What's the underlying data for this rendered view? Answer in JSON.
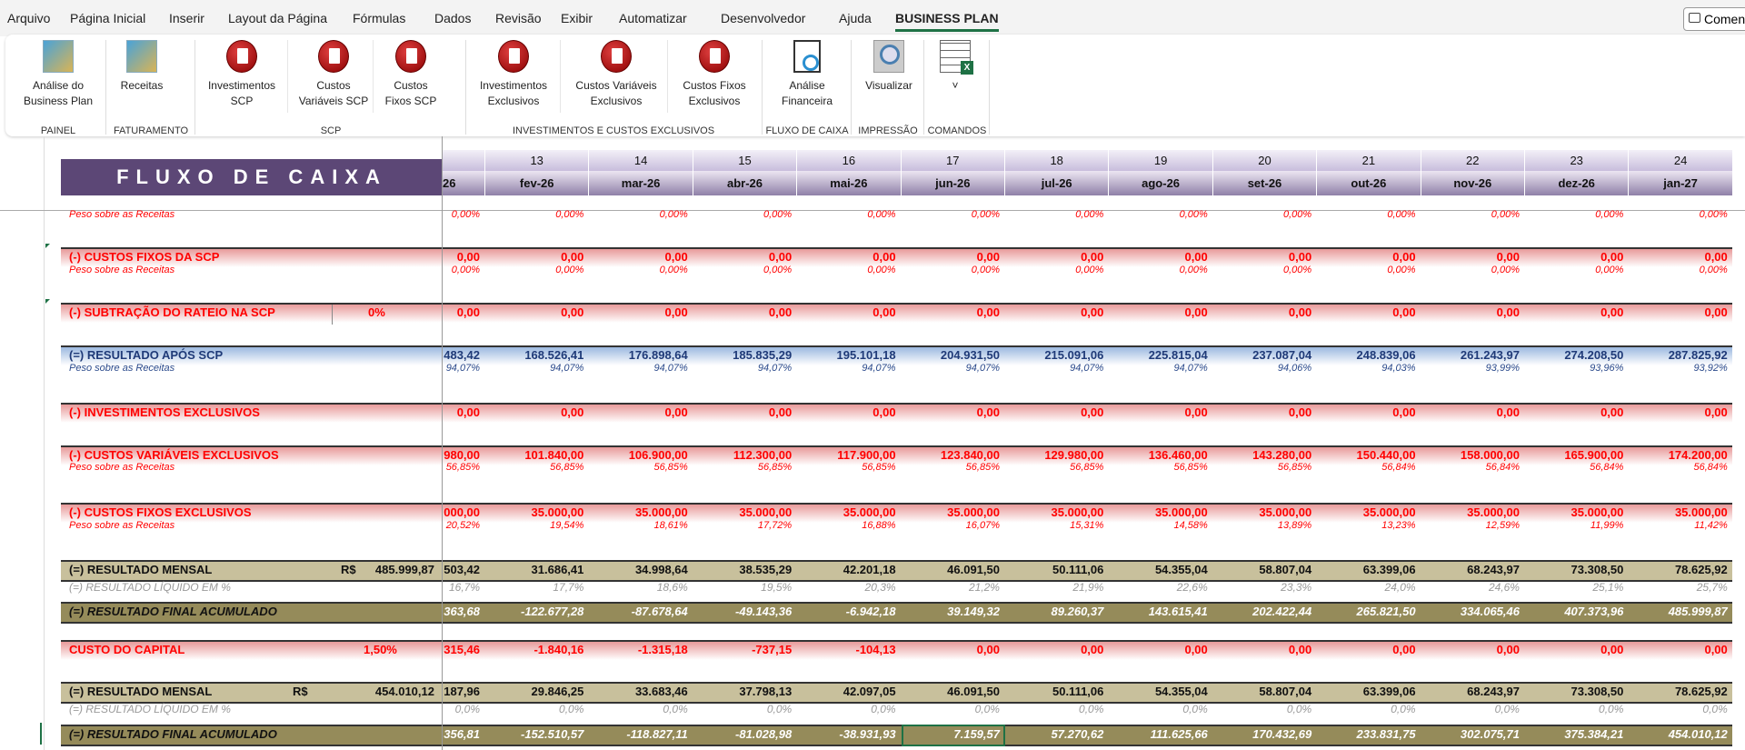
{
  "menu": [
    "Arquivo",
    "Página Inicial",
    "Inserir",
    "Layout da Página",
    "Fórmulas",
    "Dados",
    "Revisão",
    "Exibir",
    "Automatizar",
    "Desenvolvedor",
    "Ajuda",
    "BUSINESS PLAN"
  ],
  "comments_label": "Comentários",
  "ribbon": {
    "buttons": [
      {
        "label1": "Análise do",
        "label2": "Business Plan",
        "icon": "business-chart-icon"
      },
      {
        "label1": "Receitas",
        "label2": "",
        "icon": "growth-bars-icon"
      },
      {
        "label1": "Investimentos",
        "label2": "SCP",
        "icon": "red-document-icon"
      },
      {
        "label1": "Custos",
        "label2": "Variáveis SCP",
        "icon": "red-document-icon"
      },
      {
        "label1": "Custos",
        "label2": "Fixos SCP",
        "icon": "red-document-icon"
      },
      {
        "label1": "Investimentos",
        "label2": "Exclusivos",
        "icon": "red-document-icon"
      },
      {
        "label1": "Custos Variáveis",
        "label2": "Exclusivos",
        "icon": "red-document-icon"
      },
      {
        "label1": "Custos Fixos",
        "label2": "Exclusivos",
        "icon": "red-document-icon"
      },
      {
        "label1": "Análise",
        "label2": "Financeira",
        "icon": "report-magnifier-icon"
      },
      {
        "label1": "Visualizar",
        "label2": "",
        "icon": "print-preview-icon"
      },
      {
        "label1": "",
        "label2": "˅",
        "icon": "excel-grid-icon"
      }
    ],
    "groups": [
      "PAINEL",
      "FATURAMENTO",
      "SCP",
      "INVESTIMENTOS E CUSTOS EXCLUSIVOS",
      "FLUXO DE CAIXA",
      "IMPRESSÃO",
      "COMANDOS"
    ]
  },
  "sheet": {
    "title": "FLUXO DE CAIXA",
    "header_numbers": [
      "",
      "13",
      "14",
      "15",
      "16",
      "17",
      "18",
      "19",
      "20",
      "21",
      "22",
      "23",
      "24"
    ],
    "header_months": [
      "26",
      "fev-26",
      "mar-26",
      "abr-26",
      "mai-26",
      "jun-26",
      "jul-26",
      "ago-26",
      "set-26",
      "out-26",
      "nov-26",
      "dez-26",
      "jan-27"
    ],
    "rows": [
      {
        "kind": "peso-red",
        "label": "Peso sobre as Receitas",
        "values": [
          "0,00%",
          "0,00%",
          "0,00%",
          "0,00%",
          "0,00%",
          "0,00%",
          "0,00%",
          "0,00%",
          "0,00%",
          "0,00%",
          "0,00%",
          "0,00%",
          "0,00%"
        ]
      },
      {
        "kind": "red",
        "label": "(-) CUSTOS FIXOS DA SCP",
        "values": [
          "0,00",
          "0,00",
          "0,00",
          "0,00",
          "0,00",
          "0,00",
          "0,00",
          "0,00",
          "0,00",
          "0,00",
          "0,00",
          "0,00",
          "0,00"
        ]
      },
      {
        "kind": "peso-red",
        "label": "Peso sobre as Receitas",
        "values": [
          "0,00%",
          "0,00%",
          "0,00%",
          "0,00%",
          "0,00%",
          "0,00%",
          "0,00%",
          "0,00%",
          "0,00%",
          "0,00%",
          "0,00%",
          "0,00%",
          "0,00%"
        ]
      },
      {
        "kind": "red",
        "label": "(-) SUBTRAÇÃO DO RATEIO NA SCP",
        "extra": "0%",
        "values": [
          "0,00",
          "0,00",
          "0,00",
          "0,00",
          "0,00",
          "0,00",
          "0,00",
          "0,00",
          "0,00",
          "0,00",
          "0,00",
          "0,00",
          "0,00"
        ]
      },
      {
        "kind": "blue",
        "label": "(=) RESULTADO APÓS SCP",
        "values": [
          "483,42",
          "168.526,41",
          "176.898,64",
          "185.835,29",
          "195.101,18",
          "204.931,50",
          "215.091,06",
          "225.815,04",
          "237.087,04",
          "248.839,06",
          "261.243,97",
          "274.208,50",
          "287.825,92"
        ]
      },
      {
        "kind": "peso-blue",
        "label": "Peso sobre as Receitas",
        "values": [
          "94,07%",
          "94,07%",
          "94,07%",
          "94,07%",
          "94,07%",
          "94,07%",
          "94,07%",
          "94,07%",
          "94,06%",
          "94,03%",
          "93,99%",
          "93,96%",
          "93,92%"
        ]
      },
      {
        "kind": "red",
        "label": "(-) INVESTIMENTOS EXCLUSIVOS",
        "values": [
          "0,00",
          "0,00",
          "0,00",
          "0,00",
          "0,00",
          "0,00",
          "0,00",
          "0,00",
          "0,00",
          "0,00",
          "0,00",
          "0,00",
          "0,00"
        ]
      },
      {
        "kind": "red",
        "label": "(-) CUSTOS VARIÁVEIS EXCLUSIVOS",
        "values": [
          "980,00",
          "101.840,00",
          "106.900,00",
          "112.300,00",
          "117.900,00",
          "123.840,00",
          "129.980,00",
          "136.460,00",
          "143.280,00",
          "150.440,00",
          "158.000,00",
          "165.900,00",
          "174.200,00"
        ]
      },
      {
        "kind": "peso-red",
        "label": "Peso sobre as Receitas",
        "values": [
          "56,85%",
          "56,85%",
          "56,85%",
          "56,85%",
          "56,85%",
          "56,85%",
          "56,85%",
          "56,85%",
          "56,85%",
          "56,84%",
          "56,84%",
          "56,84%",
          "56,84%"
        ]
      },
      {
        "kind": "red",
        "label": "(-) CUSTOS FIXOS EXCLUSIVOS",
        "values": [
          "000,00",
          "35.000,00",
          "35.000,00",
          "35.000,00",
          "35.000,00",
          "35.000,00",
          "35.000,00",
          "35.000,00",
          "35.000,00",
          "35.000,00",
          "35.000,00",
          "35.000,00",
          "35.000,00"
        ]
      },
      {
        "kind": "peso-red",
        "label": "Peso sobre as Receitas",
        "values": [
          "20,52%",
          "19,54%",
          "18,61%",
          "17,72%",
          "16,88%",
          "16,07%",
          "15,31%",
          "14,58%",
          "13,89%",
          "13,23%",
          "12,59%",
          "11,99%",
          "11,42%"
        ]
      },
      {
        "kind": "olivel",
        "label": "(=) RESULTADO MENSAL",
        "currency": "R$",
        "total": "485.999,87",
        "values": [
          "503,42",
          "31.686,41",
          "34.998,64",
          "38.535,29",
          "42.201,18",
          "46.091,50",
          "50.111,06",
          "54.355,04",
          "58.807,04",
          "63.399,06",
          "68.243,97",
          "73.308,50",
          "78.625,92"
        ]
      },
      {
        "kind": "pct",
        "label": "(=) RESULTADO LÍQUIDO EM %",
        "values": [
          "16,7%",
          "17,7%",
          "18,6%",
          "19,5%",
          "20,3%",
          "21,2%",
          "21,9%",
          "22,6%",
          "23,3%",
          "24,0%",
          "24,6%",
          "25,1%",
          "25,7%"
        ]
      },
      {
        "kind": "olived",
        "label": "(=) RESULTADO FINAL ACUMULADO",
        "values": [
          "363,68",
          "-122.677,28",
          "-87.678,64",
          "-49.143,36",
          "-6.942,18",
          "39.149,32",
          "89.260,37",
          "143.615,41",
          "202.422,44",
          "265.821,50",
          "334.065,46",
          "407.373,96",
          "485.999,87"
        ]
      },
      {
        "kind": "red",
        "label": "CUSTO DO CAPITAL",
        "extra": "1,50%",
        "values": [
          "315,46",
          "-1.840,16",
          "-1.315,18",
          "-737,15",
          "-104,13",
          "0,00",
          "0,00",
          "0,00",
          "0,00",
          "0,00",
          "0,00",
          "0,00",
          "0,00"
        ]
      },
      {
        "kind": "olivel",
        "label": "(=) RESULTADO MENSAL",
        "currency": "R$",
        "total": "454.010,12",
        "values": [
          "187,96",
          "29.846,25",
          "33.683,46",
          "37.798,13",
          "42.097,05",
          "46.091,50",
          "50.111,06",
          "54.355,04",
          "58.807,04",
          "63.399,06",
          "68.243,97",
          "73.308,50",
          "78.625,92"
        ]
      },
      {
        "kind": "pct",
        "label": "(=) RESULTADO LÍQUIDO EM %",
        "values": [
          "0,0%",
          "0,0%",
          "0,0%",
          "0,0%",
          "0,0%",
          "0,0%",
          "0,0%",
          "0,0%",
          "0,0%",
          "0,0%",
          "0,0%",
          "0,0%",
          "0,0%"
        ]
      },
      {
        "kind": "olived",
        "label": "(=) RESULTADO FINAL ACUMULADO",
        "values": [
          "356,81",
          "-152.510,57",
          "-118.827,11",
          "-81.028,98",
          "-38.931,93",
          "7.159,57",
          "57.270,62",
          "111.625,66",
          "170.432,69",
          "233.831,75",
          "302.075,71",
          "375.384,21",
          "454.010,12"
        ]
      }
    ],
    "selected": {
      "row": 17,
      "col": 5
    }
  }
}
